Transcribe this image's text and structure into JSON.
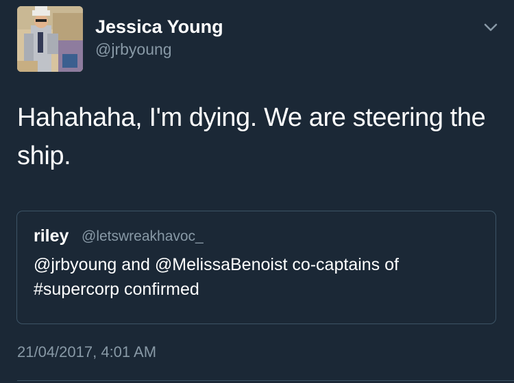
{
  "author": {
    "display_name": "Jessica Young",
    "handle": "@jrbyoung",
    "avatar": "profile-photo"
  },
  "tweet": {
    "text": "Hahahaha, I'm dying. We are steering the ship.",
    "timestamp": "21/04/2017, 4:01 AM"
  },
  "quoted_tweet": {
    "display_name": "riley",
    "handle": "@letswreakhavoc_",
    "text": "@jrbyoung and @MelissaBenoist co-captains of #supercorp confirmed"
  },
  "icons": {
    "menu": "chevron-down-icon"
  },
  "colors": {
    "background": "#1b2836",
    "secondary_text": "#8899a6",
    "border": "#3d5466",
    "primary_text": "#ffffff"
  }
}
